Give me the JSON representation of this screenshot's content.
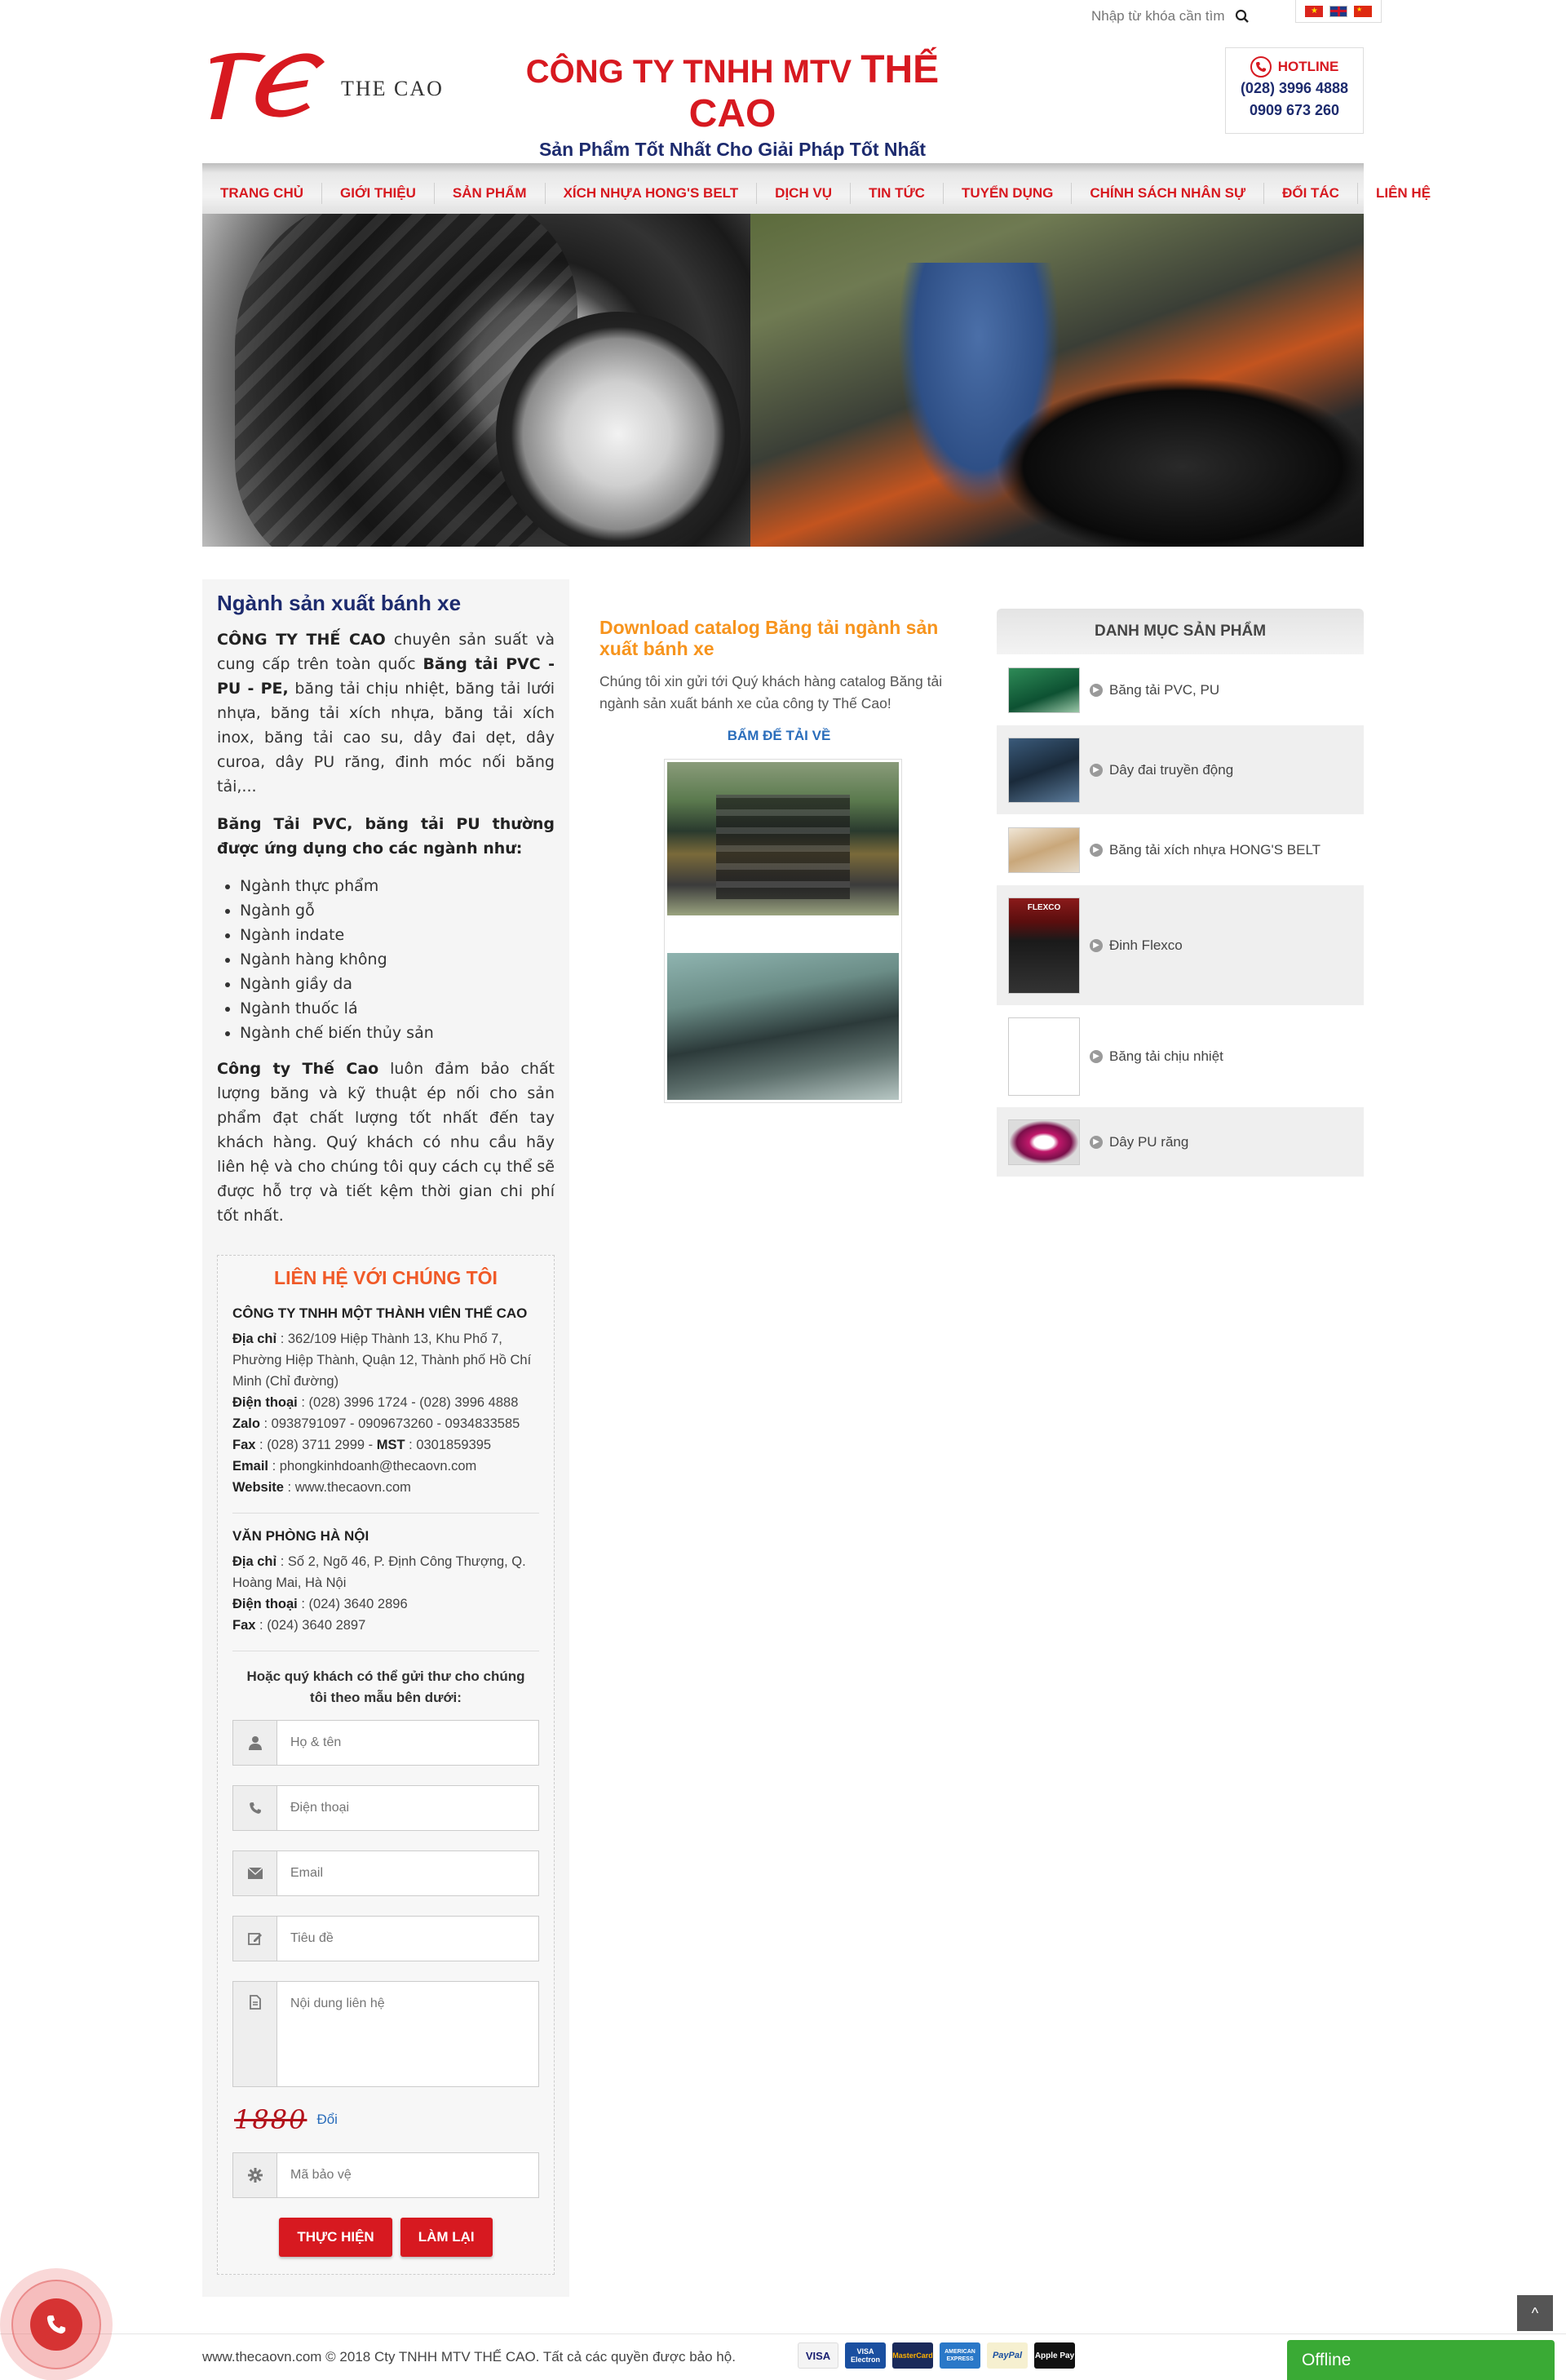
{
  "topbar": {
    "search_placeholder": "Nhập từ khóa cần tìm",
    "languages": [
      "vietnamese-flag-icon",
      "english-flag-icon",
      "chinese-flag-icon"
    ]
  },
  "header": {
    "logo_text": "THE CAO",
    "company_prefix": "CÔNG TY TNHH MTV",
    "company_brand": "THẾ CAO",
    "slogan": "Sản Phẩm Tốt Nhất Cho Giải Pháp Tốt Nhất",
    "hotline_label": "HOTLINE",
    "hotline_numbers": [
      "(028) 3996 4888",
      "0909 673 260"
    ]
  },
  "nav": {
    "items": [
      "TRANG CHỦ",
      "GIỚI THIỆU",
      "SẢN PHẨM",
      "XÍCH NHỰA HONG'S BELT",
      "DỊCH VỤ",
      "TIN TỨC",
      "TUYỂN DỤNG",
      "CHÍNH SÁCH NHÂN SỰ",
      "ĐỐI TÁC",
      "LIÊN HỆ"
    ]
  },
  "left": {
    "title": "Ngành sản xuất bánh xe",
    "intro_bold": "CÔNG TY THẾ CAO",
    "intro_mid": " chuyên sản suất và cung cấp trên toàn quốc ",
    "intro_bold2": "Băng tải PVC - PU - PE,",
    "intro_rest": " băng tải chịu nhiệt, băng tải lưới nhựa, băng tải xích nhựa, băng tải xích inox, băng tải cao su, dây đai dẹt, dây curoa, dây PU răng, đinh móc nối băng tải,...",
    "apps_heading": "Băng Tải PVC, băng tải PU thường được ứng dụng cho các ngành như:",
    "apps": [
      "Ngành thực phẩm",
      "Ngành gỗ",
      "Ngành indate",
      "Ngành hàng không",
      "Ngành giầy da",
      "Ngành thuốc lá",
      "Ngành chế biến thủy sản"
    ],
    "closing_bold": "Công ty Thế Cao",
    "closing_rest": " luôn đảm bảo chất lượng băng và kỹ thuật ép nối cho sản phẩm đạt chất lượng tốt nhất đến tay khách hàng. Quý khách có nhu cầu hãy liên hệ và cho chúng tôi quy cách cụ thể sẽ được hỗ trợ và tiết kệm thời gian chi phí tốt nhất."
  },
  "contact": {
    "title": "LIÊN HỆ VỚI CHÚNG TÔI",
    "company": "CÔNG TY TNHH MỘT THÀNH VIÊN THẾ CAO",
    "address_label": "Địa chỉ",
    "address": " : 362/109 Hiệp Thành 13, Khu Phố 7, Phường Hiệp Thành, Quận 12, Thành phố Hồ Chí Minh (Chỉ đường)",
    "phone_label": "Điện thoại",
    "phone": " : (028) 3996 1724  -  (028) 3996 4888",
    "zalo_label": "Zalo",
    "zalo": " : 0938791097 - 0909673260 - 0934833585",
    "fax_label": "Fax",
    "fax": " : (028) 3711 2999  -  ",
    "mst_label": "MST",
    "mst": " : 0301859395",
    "email_label": "Email",
    "email": " : phongkinhdoanh@thecaovn.com",
    "website_label": "Website",
    "website": " : www.thecaovn.com",
    "hn_office": "VĂN PHÒNG HÀ NỘI",
    "hn_address_label": "Địa chỉ",
    "hn_address": " : Số 2, Ngõ 46, P. Định Công Thượng, Q. Hoàng Mai, Hà Nội",
    "hn_phone_label": "Điện thoại",
    "hn_phone": " : (024) 3640 2896",
    "hn_fax_label": "Fax",
    "hn_fax": " : (024) 3640 2897",
    "form_note": "Hoặc quý khách có thể gửi thư cho chúng tôi theo mẫu bên dưới:",
    "placeholders": {
      "name": "Họ & tên",
      "phone": "Điện thoại",
      "email": "Email",
      "subject": "Tiêu đề",
      "message": "Nội dung liên hệ",
      "captcha": "Mã bảo vệ"
    },
    "captcha_code": "1880",
    "captcha_refresh": "Đổi",
    "submit": "THỰC HIỆN",
    "reset": "LÀM LẠI"
  },
  "middle": {
    "title": "Download catalog Băng tải ngành sản xuất bánh xe",
    "text": "Chúng tôi xin gửi tới Quý khách hàng catalog Băng tải ngành sản xuất bánh xe của công ty Thế Cao!",
    "download_link": "BẤM ĐỂ TẢI VỀ"
  },
  "categories": {
    "title": "DANH MỤC SẢN PHẨM",
    "items": [
      "Băng tải PVC, PU",
      "Dây đai truyền động",
      "Băng tải xích nhựa HONG'S BELT",
      "Đinh Flexco",
      "Băng tải chịu nhiệt",
      "Dây PU răng"
    ],
    "flexco_thumb_text": "FLEXCO"
  },
  "footer": {
    "copyright": "www.thecaovn.com © 2018 Cty TNHH MTV THẾ CAO. Tất cả các quyền được bảo hộ.",
    "payments": [
      "VISA",
      "VISA Electron",
      "MasterCard",
      "AMERICAN EXPRESS",
      "PayPal",
      "Apple Pay"
    ]
  },
  "widgets": {
    "chat_status": "Offline",
    "back_to_top": "^"
  },
  "colors": {
    "brand_red": "#d71920",
    "brand_navy": "#1d2b6e",
    "accent_orange": "#f7941d",
    "online_green": "#3aaa35"
  }
}
